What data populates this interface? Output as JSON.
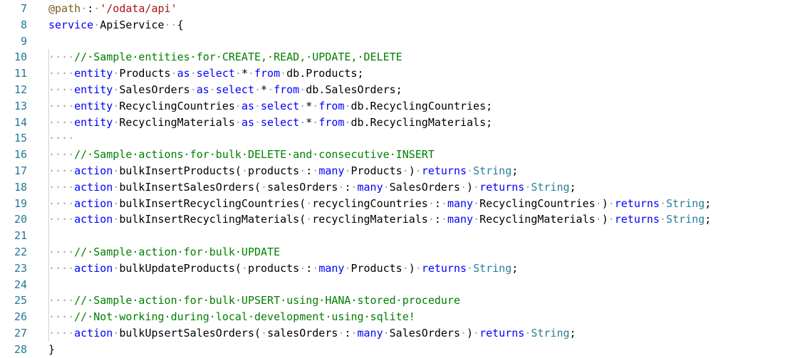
{
  "colors": {
    "background": "#ffffff",
    "line_number": "#237893",
    "keyword": "#0000ff",
    "identifier": "#000000",
    "comment": "#008000",
    "string": "#a31515",
    "annotation": "#795e26",
    "type": "#267f99",
    "whitespace_marker": "#a0a0a0",
    "indent_guide": "#d3d3d3"
  },
  "lines": [
    {
      "num": "7",
      "tokens": [
        {
          "t": "an",
          "v": "@path"
        },
        {
          "t": "ws",
          "v": "·"
        },
        {
          "t": "id",
          "v": ":"
        },
        {
          "t": "ws",
          "v": "·"
        },
        {
          "t": "st",
          "v": "'/odata/api'"
        }
      ]
    },
    {
      "num": "8",
      "tokens": [
        {
          "t": "kw",
          "v": "service"
        },
        {
          "t": "ws",
          "v": "·"
        },
        {
          "t": "id",
          "v": "ApiService"
        },
        {
          "t": "ws",
          "v": "··"
        },
        {
          "t": "id",
          "v": "{"
        }
      ]
    },
    {
      "num": "9",
      "tokens": []
    },
    {
      "num": "10",
      "tokens": [
        {
          "t": "ws",
          "v": "····"
        },
        {
          "t": "cm",
          "v": "//·Sample·entities·for·CREATE,·READ,·UPDATE,·DELETE"
        }
      ]
    },
    {
      "num": "11",
      "tokens": [
        {
          "t": "ws",
          "v": "····"
        },
        {
          "t": "kw",
          "v": "entity"
        },
        {
          "t": "ws",
          "v": "·"
        },
        {
          "t": "id",
          "v": "Products"
        },
        {
          "t": "ws",
          "v": "·"
        },
        {
          "t": "kw",
          "v": "as"
        },
        {
          "t": "ws",
          "v": "·"
        },
        {
          "t": "kw",
          "v": "select"
        },
        {
          "t": "ws",
          "v": "·"
        },
        {
          "t": "id",
          "v": "*"
        },
        {
          "t": "ws",
          "v": "·"
        },
        {
          "t": "kw",
          "v": "from"
        },
        {
          "t": "ws",
          "v": "·"
        },
        {
          "t": "id",
          "v": "db.Products;"
        }
      ]
    },
    {
      "num": "12",
      "tokens": [
        {
          "t": "ws",
          "v": "····"
        },
        {
          "t": "kw",
          "v": "entity"
        },
        {
          "t": "ws",
          "v": "·"
        },
        {
          "t": "id",
          "v": "SalesOrders"
        },
        {
          "t": "ws",
          "v": "·"
        },
        {
          "t": "kw",
          "v": "as"
        },
        {
          "t": "ws",
          "v": "·"
        },
        {
          "t": "kw",
          "v": "select"
        },
        {
          "t": "ws",
          "v": "·"
        },
        {
          "t": "id",
          "v": "*"
        },
        {
          "t": "ws",
          "v": "·"
        },
        {
          "t": "kw",
          "v": "from"
        },
        {
          "t": "ws",
          "v": "·"
        },
        {
          "t": "id",
          "v": "db.SalesOrders;"
        }
      ]
    },
    {
      "num": "13",
      "tokens": [
        {
          "t": "ws",
          "v": "····"
        },
        {
          "t": "kw",
          "v": "entity"
        },
        {
          "t": "ws",
          "v": "·"
        },
        {
          "t": "id",
          "v": "RecyclingCountries"
        },
        {
          "t": "ws",
          "v": "·"
        },
        {
          "t": "kw",
          "v": "as"
        },
        {
          "t": "ws",
          "v": "·"
        },
        {
          "t": "kw",
          "v": "select"
        },
        {
          "t": "ws",
          "v": "·"
        },
        {
          "t": "id",
          "v": "*"
        },
        {
          "t": "ws",
          "v": "·"
        },
        {
          "t": "kw",
          "v": "from"
        },
        {
          "t": "ws",
          "v": "·"
        },
        {
          "t": "id",
          "v": "db.RecyclingCountries;"
        }
      ]
    },
    {
      "num": "14",
      "tokens": [
        {
          "t": "ws",
          "v": "····"
        },
        {
          "t": "kw",
          "v": "entity"
        },
        {
          "t": "ws",
          "v": "·"
        },
        {
          "t": "id",
          "v": "RecyclingMaterials"
        },
        {
          "t": "ws",
          "v": "·"
        },
        {
          "t": "kw",
          "v": "as"
        },
        {
          "t": "ws",
          "v": "·"
        },
        {
          "t": "kw",
          "v": "select"
        },
        {
          "t": "ws",
          "v": "·"
        },
        {
          "t": "id",
          "v": "*"
        },
        {
          "t": "ws",
          "v": "·"
        },
        {
          "t": "kw",
          "v": "from"
        },
        {
          "t": "ws",
          "v": "·"
        },
        {
          "t": "id",
          "v": "db.RecyclingMaterials;"
        }
      ]
    },
    {
      "num": "15",
      "tokens": [
        {
          "t": "ws",
          "v": "····"
        }
      ]
    },
    {
      "num": "16",
      "tokens": [
        {
          "t": "ws",
          "v": "····"
        },
        {
          "t": "cm",
          "v": "//·Sample·actions·for·bulk·DELETE·and·consecutive·INSERT"
        }
      ]
    },
    {
      "num": "17",
      "tokens": [
        {
          "t": "ws",
          "v": "····"
        },
        {
          "t": "kw",
          "v": "action"
        },
        {
          "t": "ws",
          "v": "·"
        },
        {
          "t": "id",
          "v": "bulkInsertProducts("
        },
        {
          "t": "ws",
          "v": "·"
        },
        {
          "t": "id",
          "v": "products"
        },
        {
          "t": "ws",
          "v": "·"
        },
        {
          "t": "id",
          "v": ":"
        },
        {
          "t": "ws",
          "v": "·"
        },
        {
          "t": "kw",
          "v": "many"
        },
        {
          "t": "ws",
          "v": "·"
        },
        {
          "t": "id",
          "v": "Products"
        },
        {
          "t": "ws",
          "v": "·"
        },
        {
          "t": "id",
          "v": ")"
        },
        {
          "t": "ws",
          "v": "·"
        },
        {
          "t": "kw",
          "v": "returns"
        },
        {
          "t": "ws",
          "v": "·"
        },
        {
          "t": "ty",
          "v": "String"
        },
        {
          "t": "id",
          "v": ";"
        }
      ]
    },
    {
      "num": "18",
      "tokens": [
        {
          "t": "ws",
          "v": "····"
        },
        {
          "t": "kw",
          "v": "action"
        },
        {
          "t": "ws",
          "v": "·"
        },
        {
          "t": "id",
          "v": "bulkInsertSalesOrders("
        },
        {
          "t": "ws",
          "v": "·"
        },
        {
          "t": "id",
          "v": "salesOrders"
        },
        {
          "t": "ws",
          "v": "·"
        },
        {
          "t": "id",
          "v": ":"
        },
        {
          "t": "ws",
          "v": "·"
        },
        {
          "t": "kw",
          "v": "many"
        },
        {
          "t": "ws",
          "v": "·"
        },
        {
          "t": "id",
          "v": "SalesOrders"
        },
        {
          "t": "ws",
          "v": "·"
        },
        {
          "t": "id",
          "v": ")"
        },
        {
          "t": "ws",
          "v": "·"
        },
        {
          "t": "kw",
          "v": "returns"
        },
        {
          "t": "ws",
          "v": "·"
        },
        {
          "t": "ty",
          "v": "String"
        },
        {
          "t": "id",
          "v": ";"
        }
      ]
    },
    {
      "num": "19",
      "tokens": [
        {
          "t": "ws",
          "v": "····"
        },
        {
          "t": "kw",
          "v": "action"
        },
        {
          "t": "ws",
          "v": "·"
        },
        {
          "t": "id",
          "v": "bulkInsertRecyclingCountries("
        },
        {
          "t": "ws",
          "v": "·"
        },
        {
          "t": "id",
          "v": "recyclingCountries"
        },
        {
          "t": "ws",
          "v": "·"
        },
        {
          "t": "id",
          "v": ":"
        },
        {
          "t": "ws",
          "v": "·"
        },
        {
          "t": "kw",
          "v": "many"
        },
        {
          "t": "ws",
          "v": "·"
        },
        {
          "t": "id",
          "v": "RecyclingCountries"
        },
        {
          "t": "ws",
          "v": "·"
        },
        {
          "t": "id",
          "v": ")"
        },
        {
          "t": "ws",
          "v": "·"
        },
        {
          "t": "kw",
          "v": "returns"
        },
        {
          "t": "ws",
          "v": "·"
        },
        {
          "t": "ty",
          "v": "String"
        },
        {
          "t": "id",
          "v": ";"
        }
      ]
    },
    {
      "num": "20",
      "tokens": [
        {
          "t": "ws",
          "v": "····"
        },
        {
          "t": "kw",
          "v": "action"
        },
        {
          "t": "ws",
          "v": "·"
        },
        {
          "t": "id",
          "v": "bulkInsertRecyclingMaterials("
        },
        {
          "t": "ws",
          "v": "·"
        },
        {
          "t": "id",
          "v": "recyclingMaterials"
        },
        {
          "t": "ws",
          "v": "·"
        },
        {
          "t": "id",
          "v": ":"
        },
        {
          "t": "ws",
          "v": "·"
        },
        {
          "t": "kw",
          "v": "many"
        },
        {
          "t": "ws",
          "v": "·"
        },
        {
          "t": "id",
          "v": "RecyclingMaterials"
        },
        {
          "t": "ws",
          "v": "·"
        },
        {
          "t": "id",
          "v": ")"
        },
        {
          "t": "ws",
          "v": "·"
        },
        {
          "t": "kw",
          "v": "returns"
        },
        {
          "t": "ws",
          "v": "·"
        },
        {
          "t": "ty",
          "v": "String"
        },
        {
          "t": "id",
          "v": ";"
        }
      ]
    },
    {
      "num": "21",
      "tokens": []
    },
    {
      "num": "22",
      "tokens": [
        {
          "t": "ws",
          "v": "····"
        },
        {
          "t": "cm",
          "v": "//·Sample·action·for·bulk·UPDATE"
        }
      ]
    },
    {
      "num": "23",
      "tokens": [
        {
          "t": "ws",
          "v": "····"
        },
        {
          "t": "kw",
          "v": "action"
        },
        {
          "t": "ws",
          "v": "·"
        },
        {
          "t": "id",
          "v": "bulkUpdateProducts("
        },
        {
          "t": "ws",
          "v": "·"
        },
        {
          "t": "id",
          "v": "products"
        },
        {
          "t": "ws",
          "v": "·"
        },
        {
          "t": "id",
          "v": ":"
        },
        {
          "t": "ws",
          "v": "·"
        },
        {
          "t": "kw",
          "v": "many"
        },
        {
          "t": "ws",
          "v": "·"
        },
        {
          "t": "id",
          "v": "Products"
        },
        {
          "t": "ws",
          "v": "·"
        },
        {
          "t": "id",
          "v": ")"
        },
        {
          "t": "ws",
          "v": "·"
        },
        {
          "t": "kw",
          "v": "returns"
        },
        {
          "t": "ws",
          "v": "·"
        },
        {
          "t": "ty",
          "v": "String"
        },
        {
          "t": "id",
          "v": ";"
        }
      ]
    },
    {
      "num": "24",
      "tokens": []
    },
    {
      "num": "25",
      "tokens": [
        {
          "t": "ws",
          "v": "····"
        },
        {
          "t": "cm",
          "v": "//·Sample·action·for·bulk·UPSERT·using·HANA·stored·procedure"
        }
      ]
    },
    {
      "num": "26",
      "tokens": [
        {
          "t": "ws",
          "v": "····"
        },
        {
          "t": "cm",
          "v": "//·Not·working·during·local·development·using·sqlite!"
        }
      ]
    },
    {
      "num": "27",
      "tokens": [
        {
          "t": "ws",
          "v": "····"
        },
        {
          "t": "kw",
          "v": "action"
        },
        {
          "t": "ws",
          "v": "·"
        },
        {
          "t": "id",
          "v": "bulkUpsertSalesOrders("
        },
        {
          "t": "ws",
          "v": "·"
        },
        {
          "t": "id",
          "v": "salesOrders"
        },
        {
          "t": "ws",
          "v": "·"
        },
        {
          "t": "id",
          "v": ":"
        },
        {
          "t": "ws",
          "v": "·"
        },
        {
          "t": "kw",
          "v": "many"
        },
        {
          "t": "ws",
          "v": "·"
        },
        {
          "t": "id",
          "v": "SalesOrders"
        },
        {
          "t": "ws",
          "v": "·"
        },
        {
          "t": "id",
          "v": ")"
        },
        {
          "t": "ws",
          "v": "·"
        },
        {
          "t": "kw",
          "v": "returns"
        },
        {
          "t": "ws",
          "v": "·"
        },
        {
          "t": "ty",
          "v": "String"
        },
        {
          "t": "id",
          "v": ";"
        }
      ]
    },
    {
      "num": "28",
      "tokens": [
        {
          "t": "id",
          "v": "}"
        }
      ]
    }
  ]
}
